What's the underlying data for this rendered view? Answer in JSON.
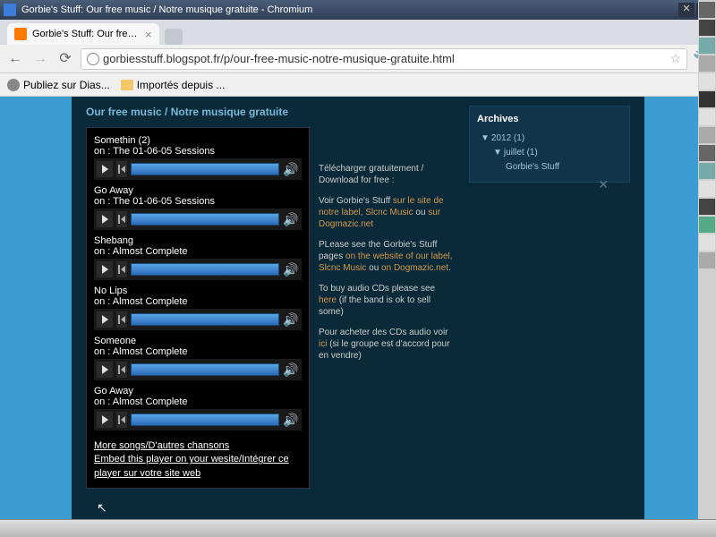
{
  "window": {
    "title": "Gorbie's Stuff: Our free music / Notre musique gratuite - Chromium"
  },
  "tab": {
    "title": "Gorbie's Stuff: Our free..."
  },
  "url": "gorbiesstuff.blogspot.fr/p/our-free-music-notre-musique-gratuite.html",
  "bookmarks": {
    "b1": "Publiez sur Dias...",
    "b2": "Importés depuis ..."
  },
  "page": {
    "title": "Our free music / Notre musique gratuite"
  },
  "tracks": [
    {
      "title": "Somethin (2)",
      "album": "on : The 01-06-05 Sessions"
    },
    {
      "title": "Go Away",
      "album": "on : The 01-06-05 Sessions"
    },
    {
      "title": "Shebang",
      "album": "on : Almost Complete"
    },
    {
      "title": "No Lips",
      "album": "on : Almost Complete"
    },
    {
      "title": "Someone",
      "album": "on : Almost Complete"
    },
    {
      "title": "Go Away",
      "album": "on : Almost Complete"
    }
  ],
  "player_links": {
    "more": "More songs/D'autres chansons",
    "embed": "Embed this player on your wesite/Intégrer ce player sur votre site web"
  },
  "sidetext": {
    "p1_a": "Télécharger gratuitement / Download for free :",
    "p2_a": "Voir Gorbie's Stuff ",
    "p2_l1": "sur le site de notre label, Slcnc Music",
    "p2_b": " ou ",
    "p2_l2": "sur Dogmazic.net",
    "p3_a": "PLease see the Gorbie's Stuff pages ",
    "p3_l1": "on the website of our label, Slcnc Music",
    "p3_b": " ou ",
    "p3_l2": "on Dogmazic.net",
    "p3_c": ".",
    "p4_a": "To buy audio CDs please see ",
    "p4_l1": "here",
    "p4_b": " (if the band is ok to sell some)",
    "p5_a": "Pour acheter des CDs audio voir ",
    "p5_l1": "ici",
    "p5_b": " (si le groupe est d'accord pour en vendre)"
  },
  "sidebar": {
    "title": "Archives",
    "y": "2012 (1)",
    "m": "juillet (1)",
    "post": "Gorbie's Stuff"
  }
}
